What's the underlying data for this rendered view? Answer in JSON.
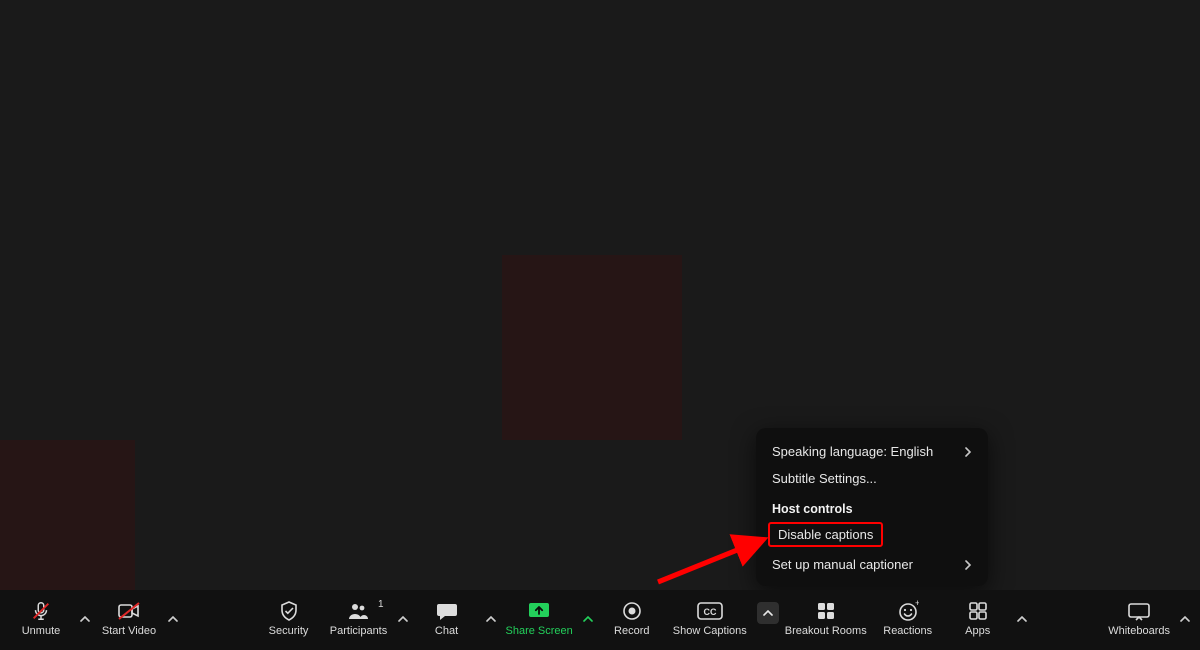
{
  "toolbar": {
    "unmute": "Unmute",
    "start_video": "Start Video",
    "security": "Security",
    "participants": "Participants",
    "participants_count": "1",
    "chat": "Chat",
    "share_screen": "Share Screen",
    "record": "Record",
    "show_captions": "Show Captions",
    "breakout_rooms": "Breakout Rooms",
    "reactions": "Reactions",
    "apps": "Apps",
    "whiteboards": "Whiteboards"
  },
  "captions_menu": {
    "speaking_language": "Speaking language: English",
    "subtitle_settings": "Subtitle Settings...",
    "host_controls_header": "Host controls",
    "disable_captions": "Disable captions",
    "setup_manual_captioner": "Set up manual captioner"
  },
  "colors": {
    "accent_green": "#23d05b",
    "annotation_red": "#ff0000"
  }
}
